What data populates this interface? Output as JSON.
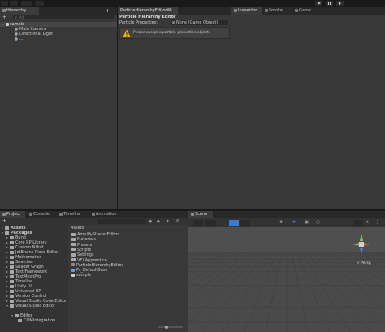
{
  "hierarchy": {
    "tab_label": "Hierarchy",
    "add_label": "+",
    "search_placeholder": "All",
    "scene_name": "sample",
    "items": [
      "Main Camera",
      "Directional Light",
      "..."
    ]
  },
  "particle_editor": {
    "tab_label": "ParticleHierarchyEditorWi...",
    "title": "Particle Hierarchy Editor",
    "field_label": "Particle Properties:",
    "field_value": "None (Game Object)",
    "warning": "Please assign a particle properties object."
  },
  "inspector": {
    "tabs": [
      "Inspector",
      "Smoke",
      "Game"
    ]
  },
  "bottom": {
    "tabs": [
      "Project",
      "Console",
      "Timeline",
      "Animation"
    ],
    "add_label": "+",
    "count_label": "16"
  },
  "project_tree": {
    "assets_label": "Assets",
    "packages_label": "Packages",
    "packages": [
      "Burst",
      "Core RP Library",
      "Custom NUnit",
      "JetBrains Rider Editor",
      "Mathematics",
      "Searcher",
      "Shader Graph",
      "Test Framework",
      "TextMeshPro",
      "Timeline",
      "Unity UI",
      "Universal RP",
      "Version Control",
      "Visual Studio Code Editor",
      "Visual Studio Editor"
    ],
    "editor_label": "Editor",
    "com_label": "COMIntegration"
  },
  "assets_view": {
    "header": "Assets",
    "items": [
      {
        "label": "AmplifyShaderEditor",
        "kind": "folder"
      },
      {
        "label": "Materials",
        "kind": "folder"
      },
      {
        "label": "Presets",
        "kind": "folder"
      },
      {
        "label": "Scripts",
        "kind": "folder"
      },
      {
        "label": "Settings",
        "kind": "folder"
      },
      {
        "label": "VFXApprentice",
        "kind": "folder"
      },
      {
        "label": "ParticleHierarchyEditor",
        "kind": "script"
      },
      {
        "label": "Ps_DefaultBase",
        "kind": "prefab"
      },
      {
        "label": "sample",
        "kind": "scene"
      }
    ]
  },
  "scene_view": {
    "tab_label": "Scene",
    "persp_label": "< Persp",
    "gizmo_axes": [
      "x",
      "y",
      "z"
    ]
  },
  "colors": {
    "selection": "#2c5d87",
    "warning": "#f0b400",
    "axis_x": "#e05050",
    "axis_y": "#8fd14f",
    "axis_z": "#4a7ee0",
    "accent_blue": "#3c78d8"
  }
}
